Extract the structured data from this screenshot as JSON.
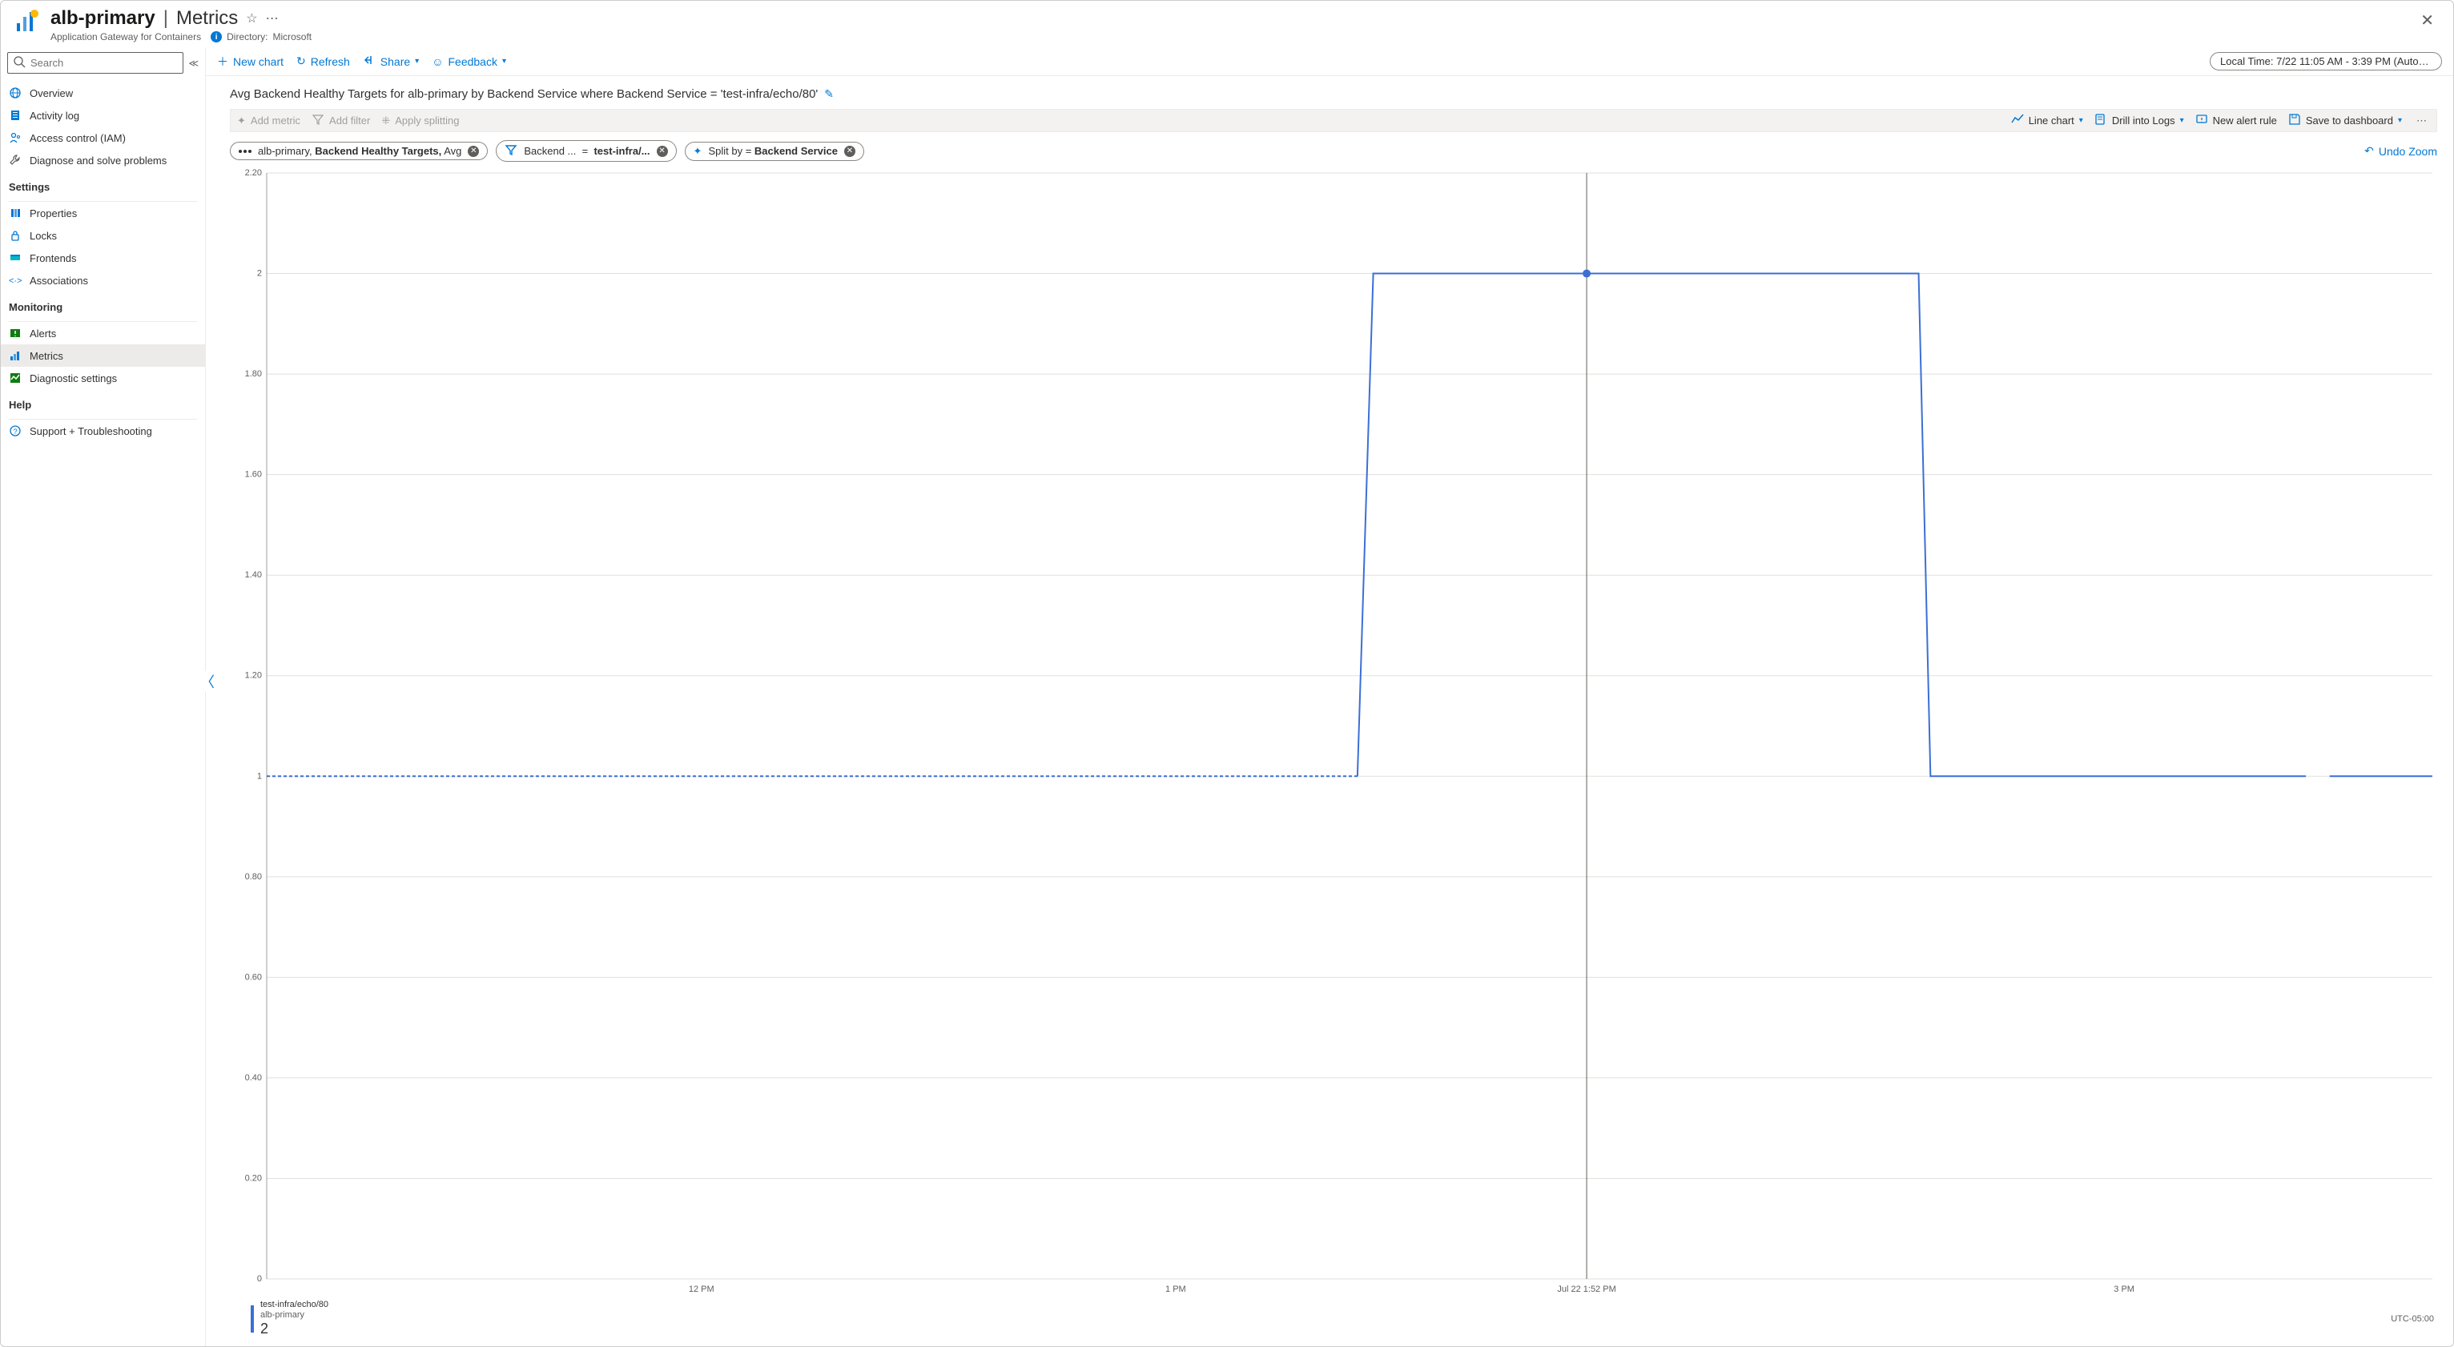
{
  "header": {
    "resource_name": "alb-primary",
    "page_name": "Metrics",
    "resource_type": "Application Gateway for Containers",
    "directory_label": "Directory:",
    "directory_value": "Microsoft"
  },
  "search": {
    "placeholder": "Search"
  },
  "sidebar": {
    "items_top": [
      {
        "label": "Overview",
        "icon": "globe"
      },
      {
        "label": "Activity log",
        "icon": "log"
      },
      {
        "label": "Access control (IAM)",
        "icon": "iam"
      },
      {
        "label": "Diagnose and solve problems",
        "icon": "wrench"
      }
    ],
    "section1_label": "Settings",
    "items_settings": [
      {
        "label": "Properties",
        "icon": "props"
      },
      {
        "label": "Locks",
        "icon": "lock"
      },
      {
        "label": "Frontends",
        "icon": "frontend"
      },
      {
        "label": "Associations",
        "icon": "assoc"
      }
    ],
    "section2_label": "Monitoring",
    "items_monitoring": [
      {
        "label": "Alerts",
        "icon": "alerts"
      },
      {
        "label": "Metrics",
        "icon": "metrics",
        "selected": true
      },
      {
        "label": "Diagnostic settings",
        "icon": "diag"
      }
    ],
    "section3_label": "Help",
    "items_help": [
      {
        "label": "Support + Troubleshooting",
        "icon": "support"
      }
    ]
  },
  "toolbar": {
    "new_chart": "New chart",
    "refresh": "Refresh",
    "share": "Share",
    "feedback": "Feedback",
    "time_range": "Local Time: 7/22 11:05 AM - 3:39 PM (Automatic..."
  },
  "chart_header": {
    "title": "Avg Backend Healthy Targets for alb-primary by Backend Service where Backend Service = 'test-infra/echo/80'"
  },
  "action_bar": {
    "add_metric": "Add metric",
    "add_filter": "Add filter",
    "apply_splitting": "Apply splitting",
    "line_chart": "Line chart",
    "drill_logs": "Drill into Logs",
    "new_alert": "New alert rule",
    "save_dashboard": "Save to dashboard"
  },
  "pills": {
    "metric_resource": "alb-primary,",
    "metric_name": "Backend Healthy Targets,",
    "metric_agg": "Avg",
    "filter_prefix": "Backend ...",
    "filter_eq": "=",
    "filter_value": "test-infra/...",
    "split_prefix": "Split by =",
    "split_value": "Backend Service",
    "undo_zoom": "Undo Zoom"
  },
  "legend": {
    "series_name": "test-infra/echo/80",
    "resource": "alb-primary",
    "value": "2"
  },
  "chart_data": {
    "type": "line",
    "title": "Avg Backend Healthy Targets for alb-primary by Backend Service where Backend Service = 'test-infra/echo/80'",
    "xlabel": "",
    "ylabel": "",
    "ylim": [
      0,
      2.2
    ],
    "y_ticks": [
      "0",
      "0.20",
      "0.40",
      "0.60",
      "0.80",
      "1",
      "1.20",
      "1.40",
      "1.60",
      "1.80",
      "2",
      "2.20"
    ],
    "x_ticks": [
      "12 PM",
      "1 PM",
      "Jul 22 1:52 PM",
      "3 PM"
    ],
    "x_tick_positions_min": [
      55,
      115,
      167,
      235
    ],
    "x_range_min": [
      0,
      274
    ],
    "utc_offset": "UTC-05:00",
    "series": [
      {
        "name": "test-infra/echo/80",
        "style_segments": [
          {
            "style": "dashed",
            "points": [
              [
                0,
                1
              ],
              [
                138,
                1
              ]
            ]
          },
          {
            "style": "solid",
            "points": [
              [
                138,
                1
              ],
              [
                140,
                2
              ],
              [
                209,
                2
              ],
              [
                210.5,
                1
              ],
              [
                258,
                1
              ]
            ]
          },
          {
            "style": "solid",
            "points": [
              [
                261,
                1
              ],
              [
                274,
                1
              ]
            ]
          }
        ]
      }
    ],
    "cursor": {
      "x_min": 167,
      "label": "Jul 22 1:52 PM",
      "marker_y": 2
    }
  }
}
